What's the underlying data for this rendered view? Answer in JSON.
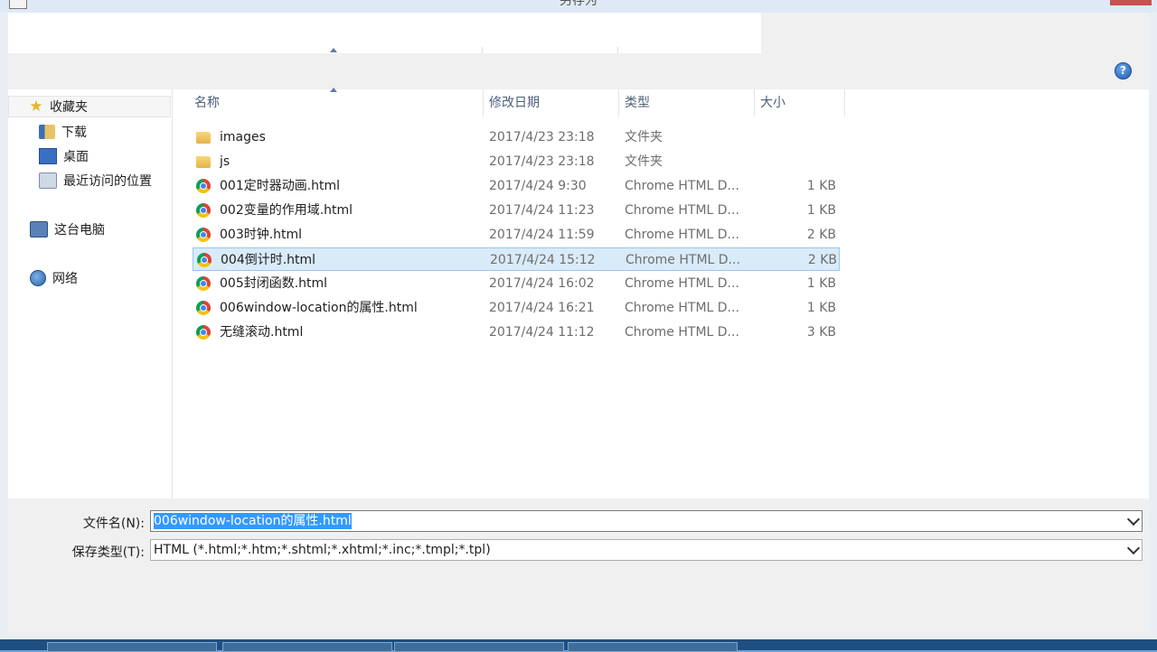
{
  "window": {
    "title": "另存为"
  },
  "nav": {
    "favorites": "收藏夹",
    "items": [
      {
        "label": "下载",
        "icon": "downloads-folder-icon"
      },
      {
        "label": "桌面",
        "icon": "desktop-icon"
      },
      {
        "label": "最近访问的位置",
        "icon": "recent-places-icon"
      }
    ],
    "this_pc": "这台电脑",
    "network": "网络"
  },
  "columns": {
    "name": "名称",
    "date": "修改日期",
    "type": "类型",
    "size": "大小"
  },
  "files": [
    {
      "name": "images",
      "date": "2017/4/23 23:18",
      "type": "文件夹",
      "size": "",
      "kind": "folder"
    },
    {
      "name": "js",
      "date": "2017/4/23 23:18",
      "type": "文件夹",
      "size": "",
      "kind": "folder"
    },
    {
      "name": "001定时器动画.html",
      "date": "2017/4/24 9:30",
      "type": "Chrome HTML D...",
      "size": "1 KB",
      "kind": "chrome"
    },
    {
      "name": "002变量的作用域.html",
      "date": "2017/4/24 11:23",
      "type": "Chrome HTML D...",
      "size": "1 KB",
      "kind": "chrome"
    },
    {
      "name": "003时钟.html",
      "date": "2017/4/24 11:59",
      "type": "Chrome HTML D...",
      "size": "2 KB",
      "kind": "chrome"
    },
    {
      "name": "004倒计时.html",
      "date": "2017/4/24 15:12",
      "type": "Chrome HTML D...",
      "size": "2 KB",
      "kind": "chrome",
      "selected": true
    },
    {
      "name": "005封闭函数.html",
      "date": "2017/4/24 16:02",
      "type": "Chrome HTML D...",
      "size": "1 KB",
      "kind": "chrome"
    },
    {
      "name": "006window-location的属性.html",
      "date": "2017/4/24 16:21",
      "type": "Chrome HTML D...",
      "size": "1 KB",
      "kind": "chrome"
    },
    {
      "name": "无缝滚动.html",
      "date": "2017/4/24 11:12",
      "type": "Chrome HTML D...",
      "size": "3 KB",
      "kind": "chrome"
    }
  ],
  "save": {
    "filename_label": "文件名(N):",
    "filename_value": "006window-location的属性.html",
    "type_label": "保存类型(T):",
    "type_value": "HTML (*.html;*.htm;*.shtml;*.xhtml;*.inc;*.tmpl;*.tpl)"
  },
  "help_label": "?",
  "colors": {
    "selection": "#d9ebf9",
    "selection_border": "#99c6ee",
    "text_highlight": "#3399ff"
  }
}
